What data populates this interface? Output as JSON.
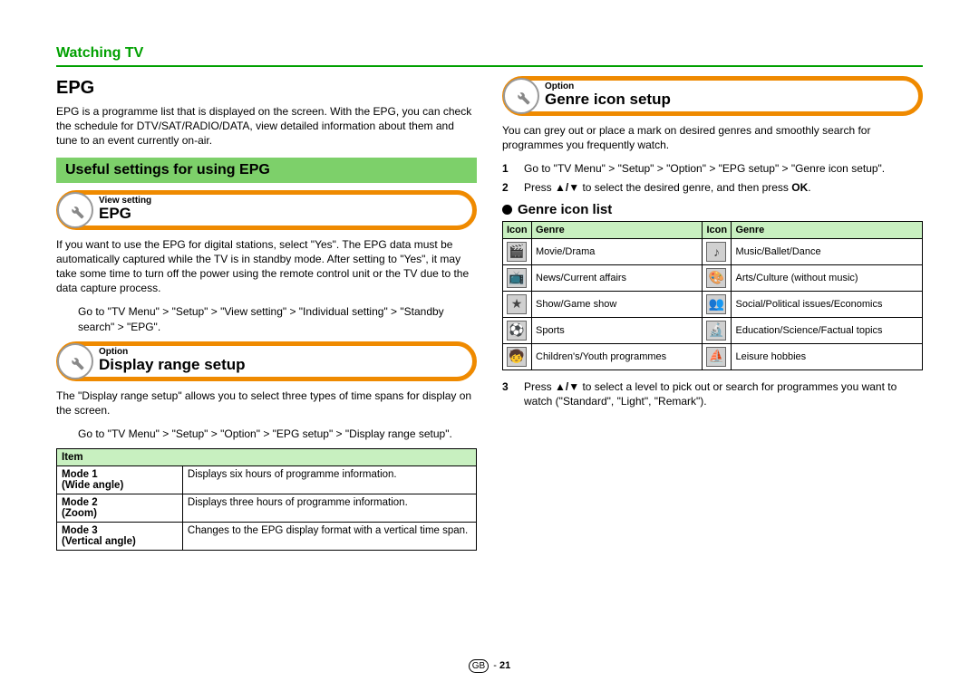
{
  "section": "Watching TV",
  "col1": {
    "h1": "EPG",
    "intro": "EPG is a programme list that is displayed on the screen. With the EPG, you can check the schedule for DTV/SAT/RADIO/DATA, view detailed information about them and tune to an event currently on-air.",
    "greenbar": "Useful settings for using EPG",
    "box1_tag": "View setting",
    "box1_title": "EPG",
    "para1": "If you want to use the EPG for digital stations, select \"Yes\". The EPG data must be automatically captured while the TV is in standby mode. After setting to \"Yes\", it may take some time to turn off the power using the remote control unit or the TV due to the data capture process.",
    "path1": "Go to \"TV Menu\" > \"Setup\" > \"View setting\" > \"Individual setting\" > \"Standby search\" > \"EPG\".",
    "box2_tag": "Option",
    "box2_title": "Display range setup",
    "para2": "The \"Display range setup\" allows you to select three types of time spans for display on the screen.",
    "path2": "Go to \"TV Menu\" > \"Setup\" > \"Option\" > \"EPG setup\" > \"Display range setup\".",
    "items_header": "Item",
    "items": [
      {
        "name_l1": "Mode 1",
        "name_l2": "Wide angle",
        "desc": "Displays six hours of programme information."
      },
      {
        "name_l1": "Mode 2",
        "name_l2": "(Zoom)",
        "desc": "Displays three hours of programme information."
      },
      {
        "name_l1": "Mode 3",
        "name_l2": "(Vertical angle)",
        "desc": "Changes to the EPG display format with a vertical time span."
      }
    ]
  },
  "col2": {
    "box3_tag": "Option",
    "box3_title": "Genre icon setup",
    "para3": "You can grey out or place a mark on desired genres and smoothly search for programmes you frequently watch.",
    "step1": "Go to \"TV Menu\" > \"Setup\" > \"Option\" > \"EPG setup\" > \"Genre icon setup\".",
    "step2a": "Press ",
    "step2b": " to select the desired genre, and then press ",
    "step2c": "OK",
    "step2d": ".",
    "subhead": "Genre icon list",
    "th_icon": "Icon",
    "th_genre": "Genre",
    "genres": [
      {
        "l": "Movie/Drama",
        "r": "Music/Ballet/Dance"
      },
      {
        "l": "News/Current affairs",
        "r": "Arts/Culture (without music)"
      },
      {
        "l": "Show/Game show",
        "r": "Social/Political issues/Economics"
      },
      {
        "l": "Sports",
        "r": "Education/Science/Factual topics"
      },
      {
        "l": "Children's/Youth programmes",
        "r": "Leisure hobbies"
      }
    ],
    "step3a": "Press ",
    "step3b": " to select a level to pick out or search for programmes you want to watch (\"Standard\", \"Light\", \"Remark\")."
  },
  "footer": {
    "lang": "GB",
    "sep": " - ",
    "page": "21"
  }
}
